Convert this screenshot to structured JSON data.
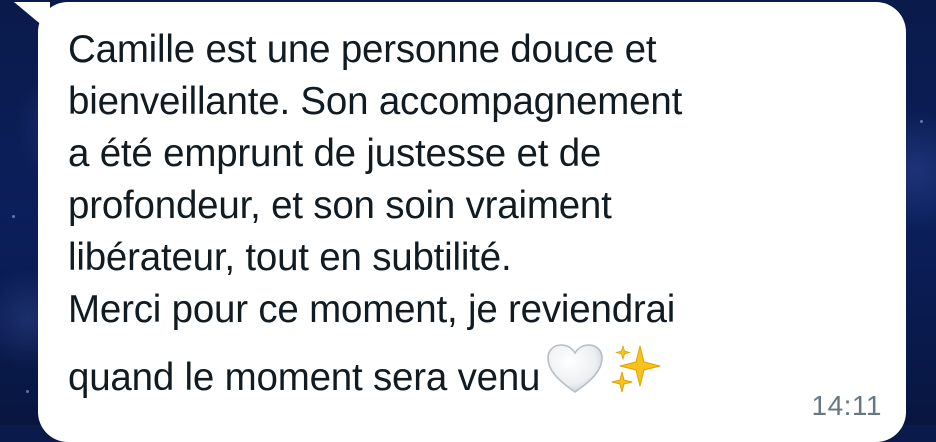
{
  "message": {
    "lines": [
      "Camille est une personne douce et",
      "bienveillante. Son accompagnement",
      "a été emprunt de justesse et de",
      "profondeur, et son soin vraiment",
      "libérateur, tout en subtilité.",
      "Merci pour ce moment, je reviendrai",
      "quand le moment sera venu"
    ],
    "emojis": [
      "white-heart-icon",
      "sparkles-icon"
    ],
    "timestamp": "14:11"
  },
  "colors": {
    "bubble": "#ffffff",
    "text": "#111b21",
    "timestamp": "#667781",
    "wallpaper": "#0b1f5c"
  }
}
